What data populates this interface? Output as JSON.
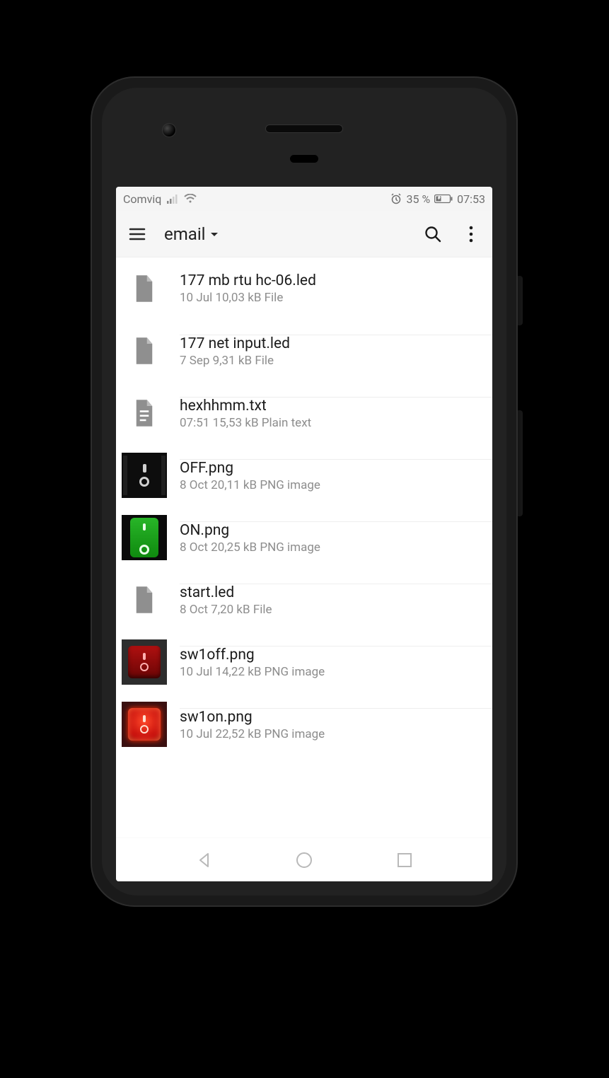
{
  "status": {
    "carrier": "Comviq",
    "battery_pct": "35 %",
    "time": "07:53",
    "icons": {
      "signal": "signal-icon",
      "wifi": "wifi-icon",
      "alarm": "alarm-icon",
      "battery": "battery-icon"
    }
  },
  "appbar": {
    "title": "email",
    "menu_icon": "hamburger-icon",
    "dropdown_icon": "chevron-down-icon",
    "search_icon": "search-icon",
    "overflow_icon": "more-vert-icon"
  },
  "files": [
    {
      "name": "177 mb rtu hc-06.led",
      "date": "10 Jul",
      "size": "10,03 kB",
      "type": "File",
      "thumb": "generic-file"
    },
    {
      "name": "177 net input.led",
      "date": "7 Sep",
      "size": "9,31 kB",
      "type": "File",
      "thumb": "generic-file"
    },
    {
      "name": "hexhhmm.txt",
      "date": "07:51",
      "size": "15,53 kB",
      "type": "Plain text",
      "thumb": "text-file"
    },
    {
      "name": "OFF.png",
      "date": "8 Oct",
      "size": "20,11 kB",
      "type": "PNG image",
      "thumb": "sw-black"
    },
    {
      "name": "ON.png",
      "date": "8 Oct",
      "size": "20,25 kB",
      "type": "PNG image",
      "thumb": "sw-green"
    },
    {
      "name": "start.led",
      "date": "8 Oct",
      "size": "7,20 kB",
      "type": "File",
      "thumb": "generic-file"
    },
    {
      "name": "sw1off.png",
      "date": "10 Jul",
      "size": "14,22 kB",
      "type": "PNG image",
      "thumb": "sw-reddark"
    },
    {
      "name": "sw1on.png",
      "date": "10 Jul",
      "size": "22,52 kB",
      "type": "PNG image",
      "thumb": "sw-redlit"
    }
  ],
  "nav": {
    "back": "back-icon",
    "home": "home-icon",
    "recents": "recents-icon"
  }
}
